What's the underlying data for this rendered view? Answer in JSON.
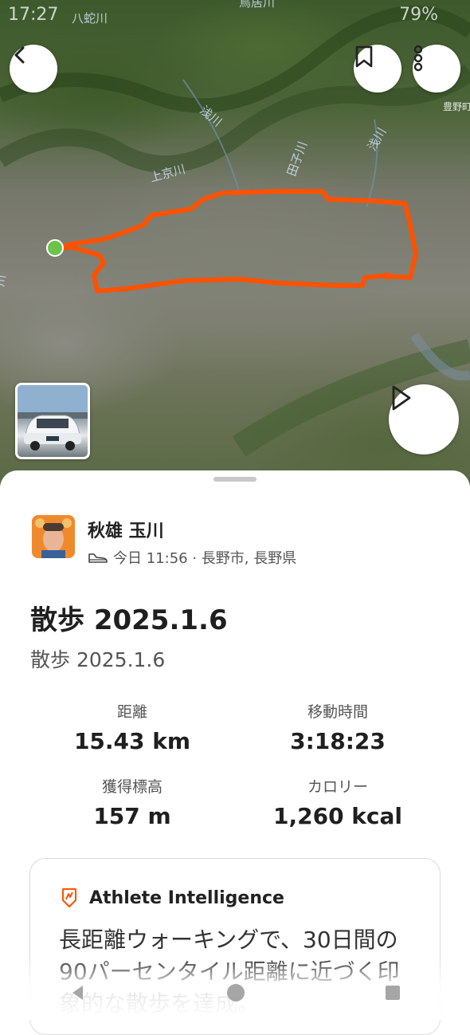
{
  "status_bar": {
    "time": "17:27",
    "battery": "79%"
  },
  "map": {
    "labels": [
      "八蛇川",
      "鳥居川",
      "浅川",
      "田子川",
      "上京川",
      "浅川",
      "豊野町",
      "川"
    ],
    "route_color": "#fc5200",
    "start_color": "#6cc24a"
  },
  "header": {
    "back_icon": "chevron-left-icon",
    "bookmark_icon": "bookmark-icon",
    "more_icon": "more-vertical-icon",
    "play_icon": "play-icon"
  },
  "athlete": {
    "name": "秋雄 玉川",
    "meta": "今日 11:56 · 長野市, 長野県",
    "activity_icon": "shoe-icon"
  },
  "activity": {
    "title": "散歩 2025.1.6",
    "description": "散歩 2025.1.6"
  },
  "stats": [
    {
      "label": "距離",
      "value": "15.43 km"
    },
    {
      "label": "移動時間",
      "value": "3:18:23"
    },
    {
      "label": "獲得標高",
      "value": "157 m"
    },
    {
      "label": "カロリー",
      "value": "1,260 kcal"
    }
  ],
  "athlete_intelligence": {
    "title": "Athlete Intelligence",
    "icon": "athlete-intelligence-icon",
    "text": "長距離ウォーキングで、30日間の90パーセンタイル距離に近づく印象的な散歩を達成。"
  },
  "nav_bar": {
    "back": "back-icon",
    "home": "home-icon",
    "recents": "recents-icon"
  }
}
